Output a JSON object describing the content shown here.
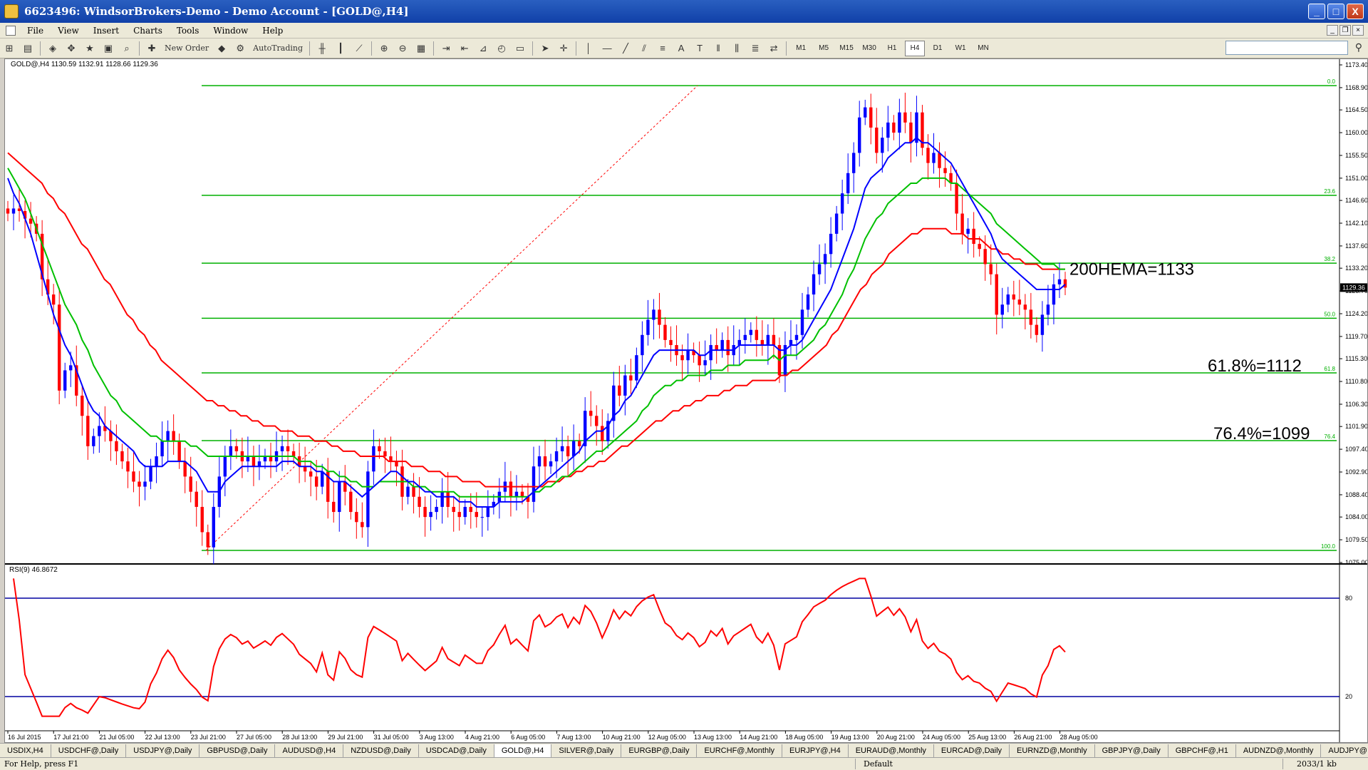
{
  "window": {
    "title": "6623496: WindsorBrokers-Demo - Demo Account - [GOLD@,H4]",
    "btn_min": "_",
    "btn_max": "□",
    "btn_close": "X"
  },
  "menu": {
    "items": [
      "File",
      "View",
      "Insert",
      "Charts",
      "Tools",
      "Window",
      "Help"
    ]
  },
  "toolbar": {
    "new_order": "New Order",
    "auto_trading": "AutoTrading",
    "timeframes": [
      "M1",
      "M5",
      "M15",
      "M30",
      "H1",
      "H4",
      "D1",
      "W1",
      "MN"
    ],
    "active_timeframe": "H4"
  },
  "chart": {
    "header": "GOLD@,H4  1130.59 1132.91 1128.66 1129.36",
    "rsi_header": "RSI(9) 46.8672",
    "current_price_label": "1129.36",
    "annotations": {
      "ema": "200HEMA=1133",
      "fib618": "61.8%=1112",
      "fib764": "76.4%=1099"
    }
  },
  "chart_data": {
    "type": "candlestick",
    "symbol": "GOLD@",
    "timeframe": "H4",
    "ylim": [
      1075.0,
      1173.4
    ],
    "yticks": [
      1173.4,
      1168.9,
      1164.5,
      1160.0,
      1155.5,
      1151.0,
      1146.6,
      1142.1,
      1137.6,
      1133.2,
      1128.7,
      1124.2,
      1119.7,
      1115.3,
      1110.8,
      1106.3,
      1101.9,
      1097.4,
      1092.9,
      1088.4,
      1084.0,
      1079.5,
      1075.0
    ],
    "xtick_labels": [
      "16 Jul 2015",
      "17 Jul 21:00",
      "21 Jul 05:00",
      "22 Jul 13:00",
      "23 Jul 21:00",
      "27 Jul 05:00",
      "28 Jul 13:00",
      "29 Jul 21:00",
      "31 Jul 05:00",
      "3 Aug 13:00",
      "4 Aug 21:00",
      "6 Aug 05:00",
      "7 Aug 13:00",
      "10 Aug 21:00",
      "12 Aug 05:00",
      "13 Aug 13:00",
      "14 Aug 21:00",
      "18 Aug 05:00",
      "19 Aug 13:00",
      "20 Aug 21:00",
      "24 Aug 05:00",
      "25 Aug 13:00",
      "26 Aug 21:00",
      "28 Aug 05:00"
    ],
    "fibonacci": {
      "levels": [
        {
          "label": "0.0",
          "price": 1169.3
        },
        {
          "label": "23.6",
          "price": 1147.6
        },
        {
          "label": "38.2",
          "price": 1134.2
        },
        {
          "label": "50.0",
          "price": 1123.3
        },
        {
          "label": "61.8",
          "price": 1112.5
        },
        {
          "label": "76.4",
          "price": 1099.1
        },
        {
          "label": "100.0",
          "price": 1077.4
        }
      ]
    },
    "rsi": {
      "period": 9,
      "levels": [
        80,
        20
      ],
      "last_value": 46.8672
    },
    "closes": [
      1144,
      1145,
      1144.5,
      1143,
      1142,
      1140,
      1131,
      1128,
      1126,
      1109,
      1113,
      1114,
      1108,
      1104,
      1098,
      1100,
      1102,
      1101,
      1099,
      1097,
      1095,
      1093,
      1091,
      1090,
      1091,
      1094,
      1096,
      1099,
      1101,
      1099,
      1095,
      1092,
      1089,
      1086,
      1081,
      1078,
      1086,
      1092,
      1096,
      1098,
      1097,
      1095,
      1096,
      1094,
      1095,
      1096,
      1095,
      1097,
      1098,
      1097,
      1096,
      1094,
      1093,
      1092,
      1090,
      1093,
      1087,
      1085,
      1091,
      1089,
      1085,
      1083,
      1082,
      1093,
      1098,
      1097,
      1096,
      1095,
      1094,
      1088,
      1090,
      1088,
      1086,
      1084,
      1085,
      1086,
      1089,
      1086,
      1085,
      1084,
      1086,
      1085,
      1084,
      1084,
      1086,
      1087,
      1089,
      1091,
      1088,
      1089,
      1088,
      1087,
      1094,
      1096,
      1094,
      1095,
      1097,
      1098,
      1096,
      1099,
      1098,
      1105,
      1104,
      1102,
      1099,
      1103,
      1110,
      1108,
      1112,
      1111,
      1116,
      1120,
      1123,
      1125,
      1122,
      1119,
      1118,
      1116,
      1115,
      1117,
      1116,
      1114,
      1115,
      1118,
      1117,
      1119,
      1116,
      1118,
      1119,
      1120,
      1121,
      1119,
      1118,
      1120,
      1118,
      1112,
      1118,
      1119,
      1120,
      1125,
      1128,
      1132,
      1134,
      1136,
      1140,
      1144,
      1148,
      1152,
      1156,
      1163,
      1165,
      1161,
      1156,
      1159,
      1162,
      1160,
      1164,
      1162,
      1158,
      1164,
      1157,
      1154,
      1156,
      1153,
      1152,
      1150,
      1144,
      1140,
      1141,
      1138,
      1137,
      1134,
      1132,
      1124,
      1126,
      1128,
      1127,
      1126,
      1125,
      1122,
      1120,
      1124,
      1126,
      1130,
      1131,
      1129.36
    ],
    "ema_blue": [
      1151,
      1148,
      1146,
      1143,
      1140,
      1136,
      1132,
      1128,
      1124,
      1121,
      1118,
      1116,
      1113,
      1110,
      1107,
      1105,
      1104,
      1102,
      1101,
      1100,
      1099,
      1098,
      1097,
      1095,
      1094,
      1094,
      1094,
      1094,
      1095,
      1095,
      1095,
      1095,
      1094,
      1093,
      1091,
      1089,
      1089,
      1089,
      1091,
      1092,
      1093,
      1094,
      1094,
      1094,
      1094,
      1094,
      1094,
      1094,
      1095,
      1095,
      1095,
      1094,
      1094,
      1094,
      1093,
      1093,
      1092,
      1091,
      1091,
      1091,
      1090,
      1089,
      1088,
      1089,
      1090,
      1091,
      1092,
      1093,
      1093,
      1092,
      1091,
      1091,
      1090,
      1089,
      1089,
      1088,
      1088,
      1088,
      1088,
      1087,
      1087,
      1087,
      1086,
      1086,
      1086,
      1086,
      1087,
      1087,
      1087,
      1087,
      1087,
      1088,
      1089,
      1090,
      1091,
      1092,
      1093,
      1094,
      1095,
      1096,
      1097,
      1099,
      1100,
      1101,
      1101,
      1102,
      1104,
      1105,
      1107,
      1108,
      1110,
      1112,
      1114,
      1116,
      1117,
      1117,
      1117,
      1117,
      1117,
      1117,
      1117,
      1116,
      1116,
      1117,
      1117,
      1117,
      1117,
      1117,
      1118,
      1118,
      1118,
      1118,
      1118,
      1118,
      1118,
      1117,
      1117,
      1118,
      1118,
      1119,
      1121,
      1123,
      1125,
      1127,
      1129,
      1132,
      1135,
      1138,
      1141,
      1145,
      1149,
      1151,
      1152,
      1153,
      1155,
      1156,
      1157,
      1158,
      1158,
      1159,
      1158,
      1158,
      1157,
      1156,
      1155,
      1154,
      1152,
      1150,
      1148,
      1146,
      1144,
      1142,
      1140,
      1137,
      1135,
      1134,
      1133,
      1132,
      1131,
      1130,
      1129,
      1129,
      1129,
      1129,
      1129,
      1130
    ],
    "ema_green": [
      1153,
      1151,
      1149,
      1147,
      1144,
      1141,
      1138,
      1135,
      1132,
      1129,
      1126,
      1124,
      1122,
      1119,
      1117,
      1114,
      1112,
      1110,
      1108,
      1107,
      1105,
      1104,
      1103,
      1102,
      1101,
      1100,
      1100,
      1099,
      1099,
      1099,
      1099,
      1099,
      1098,
      1098,
      1097,
      1096,
      1096,
      1096,
      1096,
      1096,
      1096,
      1096,
      1096,
      1096,
      1096,
      1096,
      1096,
      1096,
      1096,
      1096,
      1096,
      1095,
      1095,
      1095,
      1094,
      1094,
      1093,
      1093,
      1092,
      1092,
      1091,
      1091,
      1090,
      1090,
      1090,
      1091,
      1091,
      1091,
      1091,
      1091,
      1091,
      1090,
      1090,
      1090,
      1089,
      1089,
      1089,
      1089,
      1089,
      1088,
      1088,
      1088,
      1088,
      1088,
      1088,
      1088,
      1088,
      1088,
      1088,
      1088,
      1088,
      1088,
      1089,
      1089,
      1090,
      1090,
      1091,
      1092,
      1092,
      1093,
      1094,
      1095,
      1096,
      1097,
      1097,
      1098,
      1099,
      1100,
      1101,
      1102,
      1103,
      1105,
      1106,
      1108,
      1109,
      1110,
      1110,
      1111,
      1111,
      1112,
      1112,
      1112,
      1112,
      1113,
      1113,
      1113,
      1114,
      1114,
      1114,
      1115,
      1115,
      1115,
      1115,
      1115,
      1116,
      1115,
      1116,
      1116,
      1116,
      1117,
      1118,
      1119,
      1121,
      1122,
      1124,
      1126,
      1128,
      1131,
      1133,
      1136,
      1139,
      1141,
      1143,
      1144,
      1146,
      1147,
      1148,
      1149,
      1150,
      1150,
      1151,
      1151,
      1151,
      1151,
      1151,
      1150,
      1150,
      1149,
      1148,
      1147,
      1146,
      1145,
      1144,
      1142,
      1141,
      1140,
      1139,
      1138,
      1137,
      1136,
      1135,
      1134,
      1134,
      1134,
      1133,
      1133
    ],
    "ema_red": [
      1156,
      1155,
      1154,
      1153,
      1152,
      1151,
      1150,
      1148,
      1147,
      1145,
      1144,
      1142,
      1140,
      1138,
      1137,
      1135,
      1133,
      1131,
      1130,
      1128,
      1126,
      1124,
      1123,
      1121,
      1120,
      1118,
      1117,
      1115,
      1114,
      1113,
      1112,
      1111,
      1110,
      1109,
      1108,
      1107,
      1107,
      1106,
      1106,
      1105,
      1105,
      1104,
      1104,
      1103,
      1103,
      1102,
      1102,
      1102,
      1101,
      1101,
      1101,
      1100,
      1100,
      1100,
      1099,
      1099,
      1099,
      1098,
      1098,
      1097,
      1097,
      1097,
      1096,
      1096,
      1096,
      1096,
      1096,
      1095,
      1095,
      1095,
      1095,
      1094,
      1094,
      1094,
      1093,
      1093,
      1093,
      1092,
      1092,
      1092,
      1091,
      1091,
      1091,
      1091,
      1090,
      1090,
      1090,
      1090,
      1090,
      1090,
      1090,
      1090,
      1090,
      1090,
      1090,
      1091,
      1091,
      1091,
      1092,
      1092,
      1093,
      1093,
      1094,
      1094,
      1095,
      1095,
      1096,
      1097,
      1098,
      1098,
      1099,
      1100,
      1101,
      1102,
      1103,
      1103,
      1104,
      1105,
      1105,
      1106,
      1106,
      1107,
      1107,
      1108,
      1108,
      1108,
      1109,
      1109,
      1110,
      1110,
      1110,
      1111,
      1111,
      1111,
      1111,
      1111,
      1112,
      1112,
      1113,
      1113,
      1114,
      1115,
      1116,
      1117,
      1118,
      1120,
      1121,
      1123,
      1125,
      1127,
      1129,
      1130,
      1132,
      1133,
      1134,
      1136,
      1137,
      1138,
      1139,
      1140,
      1140,
      1141,
      1141,
      1141,
      1141,
      1141,
      1140,
      1140,
      1140,
      1139,
      1139,
      1139,
      1138,
      1137,
      1137,
      1136,
      1136,
      1135,
      1135,
      1134,
      1134,
      1134,
      1133,
      1133,
      1133,
      1133,
      1133
    ]
  },
  "tabs": [
    "USDIX,H4",
    "USDCHF@,Daily",
    "USDJPY@,Daily",
    "GBPUSD@,Daily",
    "AUDUSD@,H4",
    "NZDUSD@,Daily",
    "USDCAD@,Daily",
    "GOLD@,H4",
    "SILVER@,Daily",
    "EURGBP@,Daily",
    "EURCHF@,Monthly",
    "EURJPY@,H4",
    "EURAUD@,Monthly",
    "EURCAD@,Daily",
    "EURNZD@,Monthly",
    "GBPJPY@,Daily",
    "GBPCHF@,H1",
    "AUDNZD@,Monthly",
    "AUDJPY@,Weekly"
  ],
  "active_tab": "GOLD@,H4",
  "status": {
    "help": "For Help, press F1",
    "profile": "Default",
    "traffic": "2033/1 kb"
  },
  "colors": {
    "bull": "#0000ff",
    "bear": "#ff0000",
    "fib": "#00b000",
    "ema_blue": "#0000ff",
    "ema_green": "#00c000",
    "ema_red": "#ff0000",
    "rsi": "#ff0000",
    "rsi_level": "#0000a0"
  }
}
